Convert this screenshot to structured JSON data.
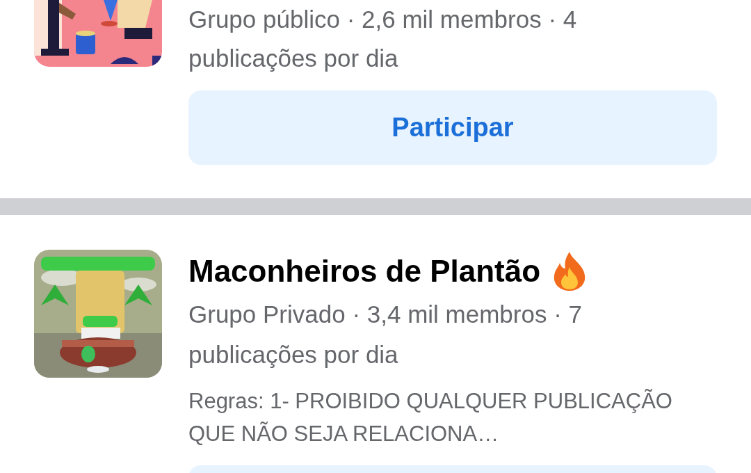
{
  "groups": [
    {
      "kind": "partial",
      "meta": "Grupo público · 2,6 mil membros · 4 publicações por dia",
      "button": "Participar"
    },
    {
      "kind": "full",
      "name": "Maconheiros de Plantão",
      "hot": true,
      "meta": "Grupo Privado · 3,4 mil membros · 7 publicações por dia",
      "rules": "Regras: 1- PROIBIDO QUALQUER PUBLICAÇÃO QUE NÃO SEJA RELACIONA…"
    }
  ]
}
